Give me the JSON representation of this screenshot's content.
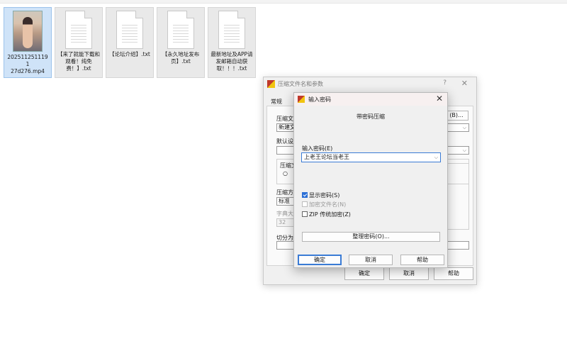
{
  "desktop": {
    "files": [
      {
        "name": "2025112511191\n27d276.mp4",
        "type": "video"
      },
      {
        "name": "【来了就能下载和观看！纯免费！】.txt",
        "type": "text"
      },
      {
        "name": "【论坛介绍】.txt",
        "type": "text"
      },
      {
        "name": "【永久地址发布页】.txt",
        "type": "text"
      },
      {
        "name": "最新地址及APP请发邮箱自动获取！！！.txt",
        "type": "text"
      }
    ]
  },
  "archive_dialog": {
    "title": "压缩文件名和参数",
    "help_label": "?",
    "close_label": "✕",
    "tab_general": "常规",
    "label_archive_name": "压缩文",
    "field_archive_name": "新建文",
    "browse_label": "(B)...",
    "label_profile": "默认设",
    "label_format": "压缩文",
    "radio_label": "○",
    "label_method": "压缩方",
    "field_method": "标准",
    "label_dictionary": "字典大",
    "field_dictionary": "32",
    "label_split": "切分为",
    "ok_label": "确定",
    "cancel_label": "取消",
    "help_button": "帮助"
  },
  "password_dialog": {
    "title": "输入密码",
    "close_label": "✕",
    "heading": "带密码压缩",
    "password_label": "输入密码(E)",
    "password_value": "上老王论坛当老王",
    "show_password": "显示密码(S)",
    "encrypt_names": "加密文件名(N)",
    "zip_legacy": "ZIP 传统加密(Z)",
    "organize_label": "整理密码(O)...",
    "ok_label": "确定",
    "cancel_label": "取消",
    "help_label": "帮助"
  }
}
